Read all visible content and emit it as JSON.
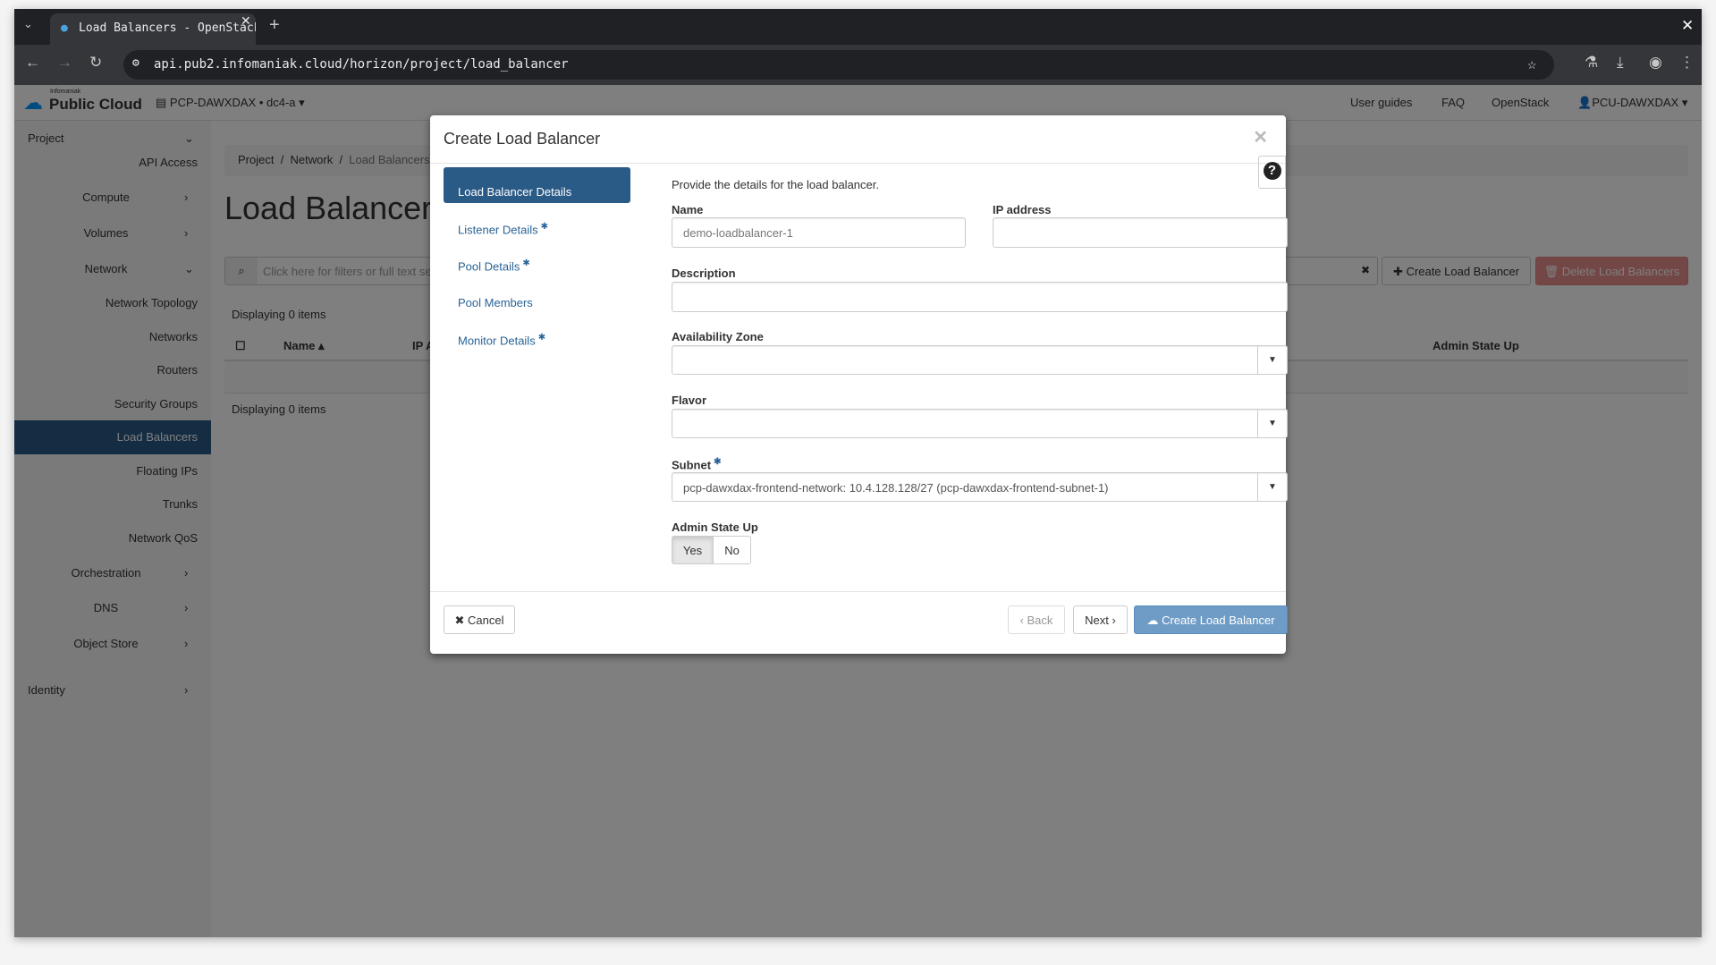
{
  "browser": {
    "tab_title": "Load Balancers - OpenStack",
    "url": "api.pub2.infomaniak.cloud/horizon/project/load_balancer"
  },
  "header": {
    "brand_small": "Infomaniak",
    "brand": "Public Cloud",
    "project_selector": "PCP-DAWXDAX • dc4-a",
    "links": [
      "User guides",
      "FAQ",
      "OpenStack"
    ],
    "user": "PCU-DAWXDAX"
  },
  "sidebar": {
    "project": "Project",
    "items": [
      {
        "label": "API Access"
      },
      {
        "label": "Compute",
        "chevron": "right"
      },
      {
        "label": "Volumes",
        "chevron": "right"
      },
      {
        "label": "Network",
        "chevron": "down"
      },
      {
        "label": "Network Topology"
      },
      {
        "label": "Networks"
      },
      {
        "label": "Routers"
      },
      {
        "label": "Security Groups"
      },
      {
        "label": "Load Balancers",
        "active": true
      },
      {
        "label": "Floating IPs"
      },
      {
        "label": "Trunks"
      },
      {
        "label": "Network QoS"
      },
      {
        "label": "Orchestration",
        "chevron": "right"
      },
      {
        "label": "DNS",
        "chevron": "right"
      },
      {
        "label": "Object Store",
        "chevron": "right"
      }
    ],
    "identity": "Identity"
  },
  "main": {
    "breadcrumb": [
      "Project",
      "Network",
      "Load Balancers"
    ],
    "title": "Load Balancers",
    "filter_placeholder": "Click here for filters or full text search.",
    "create_button": "Create Load Balancer",
    "delete_button": "Delete Load Balancers",
    "displaying": "Displaying 0 items",
    "columns": [
      "Name",
      "IP Address",
      "Admin State Up"
    ]
  },
  "modal": {
    "title": "Create Load Balancer",
    "steps": [
      {
        "label": "Load Balancer Details",
        "active": true
      },
      {
        "label": "Listener Details",
        "required": true
      },
      {
        "label": "Pool Details",
        "required": true
      },
      {
        "label": "Pool Members"
      },
      {
        "label": "Monitor Details",
        "required": true
      }
    ],
    "intro": "Provide the details for the load balancer.",
    "name_label": "Name",
    "name_placeholder": "demo-loadbalancer-1",
    "ip_label": "IP address",
    "description_label": "Description",
    "az_label": "Availability Zone",
    "flavor_label": "Flavor",
    "subnet_label": "Subnet",
    "subnet_value": "pcp-dawxdax-frontend-network: 10.4.128.128/27 (pcp-dawxdax-frontend-subnet-1)",
    "admin_label": "Admin State Up",
    "yes": "Yes",
    "no": "No",
    "selected_admin": "Yes",
    "cancel": "Cancel",
    "back": "Back",
    "next": "Next",
    "create": "Create Load Balancer"
  },
  "colors": {
    "accent": "#2a6496",
    "active_nav": "#2a5a86",
    "danger": "#d9534f",
    "create": "#5b8fbf"
  }
}
